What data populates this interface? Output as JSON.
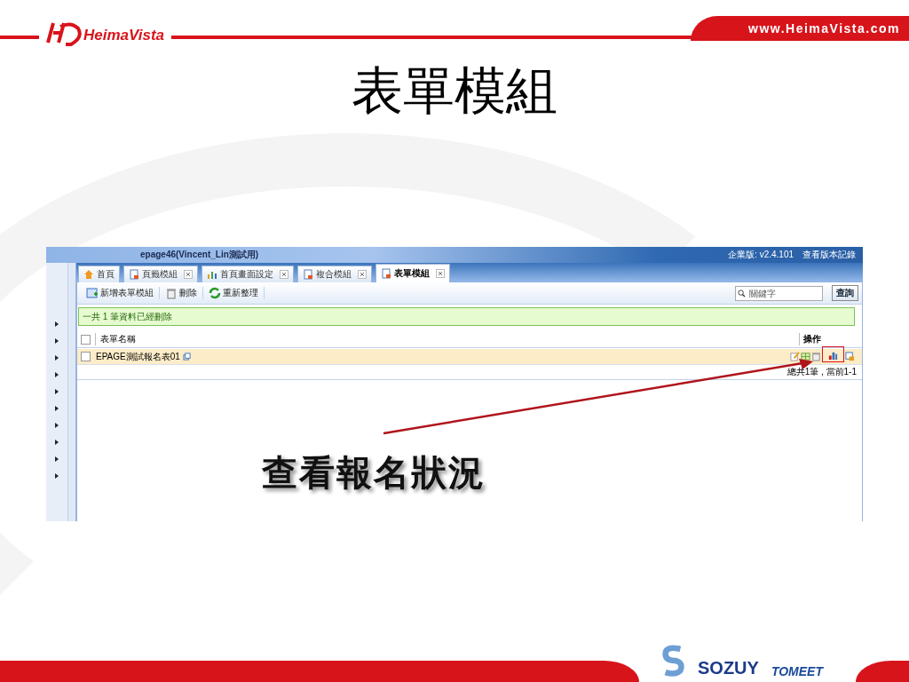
{
  "header": {
    "brand": "HeimaVista",
    "url": "www.HeimaVista.com"
  },
  "title": "表單模組",
  "app": {
    "window_title": "epage46(Vincent_Lin測試用)",
    "version": "企業版: v2.4.101",
    "version_link": "查看版本記錄",
    "tabs": [
      {
        "label": "首頁",
        "kind": "home",
        "closable": false,
        "selected": false
      },
      {
        "label": "頁籤模組",
        "kind": "page",
        "closable": true,
        "selected": false
      },
      {
        "label": "首頁畫面設定",
        "kind": "chart",
        "closable": true,
        "selected": false
      },
      {
        "label": "複合模組",
        "kind": "page",
        "closable": true,
        "selected": false
      },
      {
        "label": "表單模組",
        "kind": "page",
        "closable": true,
        "selected": true
      }
    ],
    "toolbar": [
      {
        "label": "新增表單模組",
        "kind": "add"
      },
      {
        "label": "刪除",
        "kind": "trash"
      },
      {
        "label": "重新整理",
        "kind": "refresh"
      }
    ],
    "select_all": {
      "checked": false
    },
    "search": {
      "placeholder": "關鍵字",
      "button": "查詢"
    },
    "notice": "一共 1 筆資料已經刪除",
    "columns": [
      "表單名稱",
      "操作"
    ],
    "rows": [
      {
        "name": "EPAGE測試報名表01",
        "checked": false,
        "highlighted": true
      }
    ],
    "pager": "總共1筆 , 當前1-1"
  },
  "callout": "查看報名狀況",
  "footer_logos": [
    "SOZUY",
    "TOMEET"
  ]
}
